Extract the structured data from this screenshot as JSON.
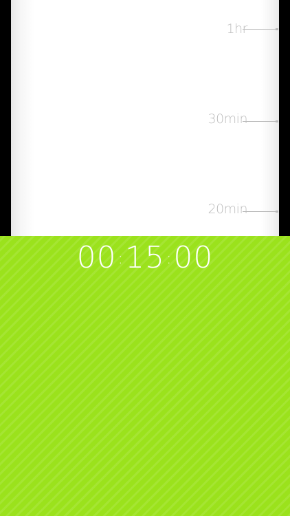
{
  "colors": {
    "background": "#000000",
    "card": "#ffffff",
    "fill": "#9be21c",
    "timer_text": "#ffffff",
    "scale_text": "#bdbdbd"
  },
  "scale": {
    "labels": [
      "1hr",
      "30min",
      "20min"
    ]
  },
  "timer": {
    "hours": "00",
    "minutes": "15",
    "seconds": "00",
    "separator": ":"
  }
}
